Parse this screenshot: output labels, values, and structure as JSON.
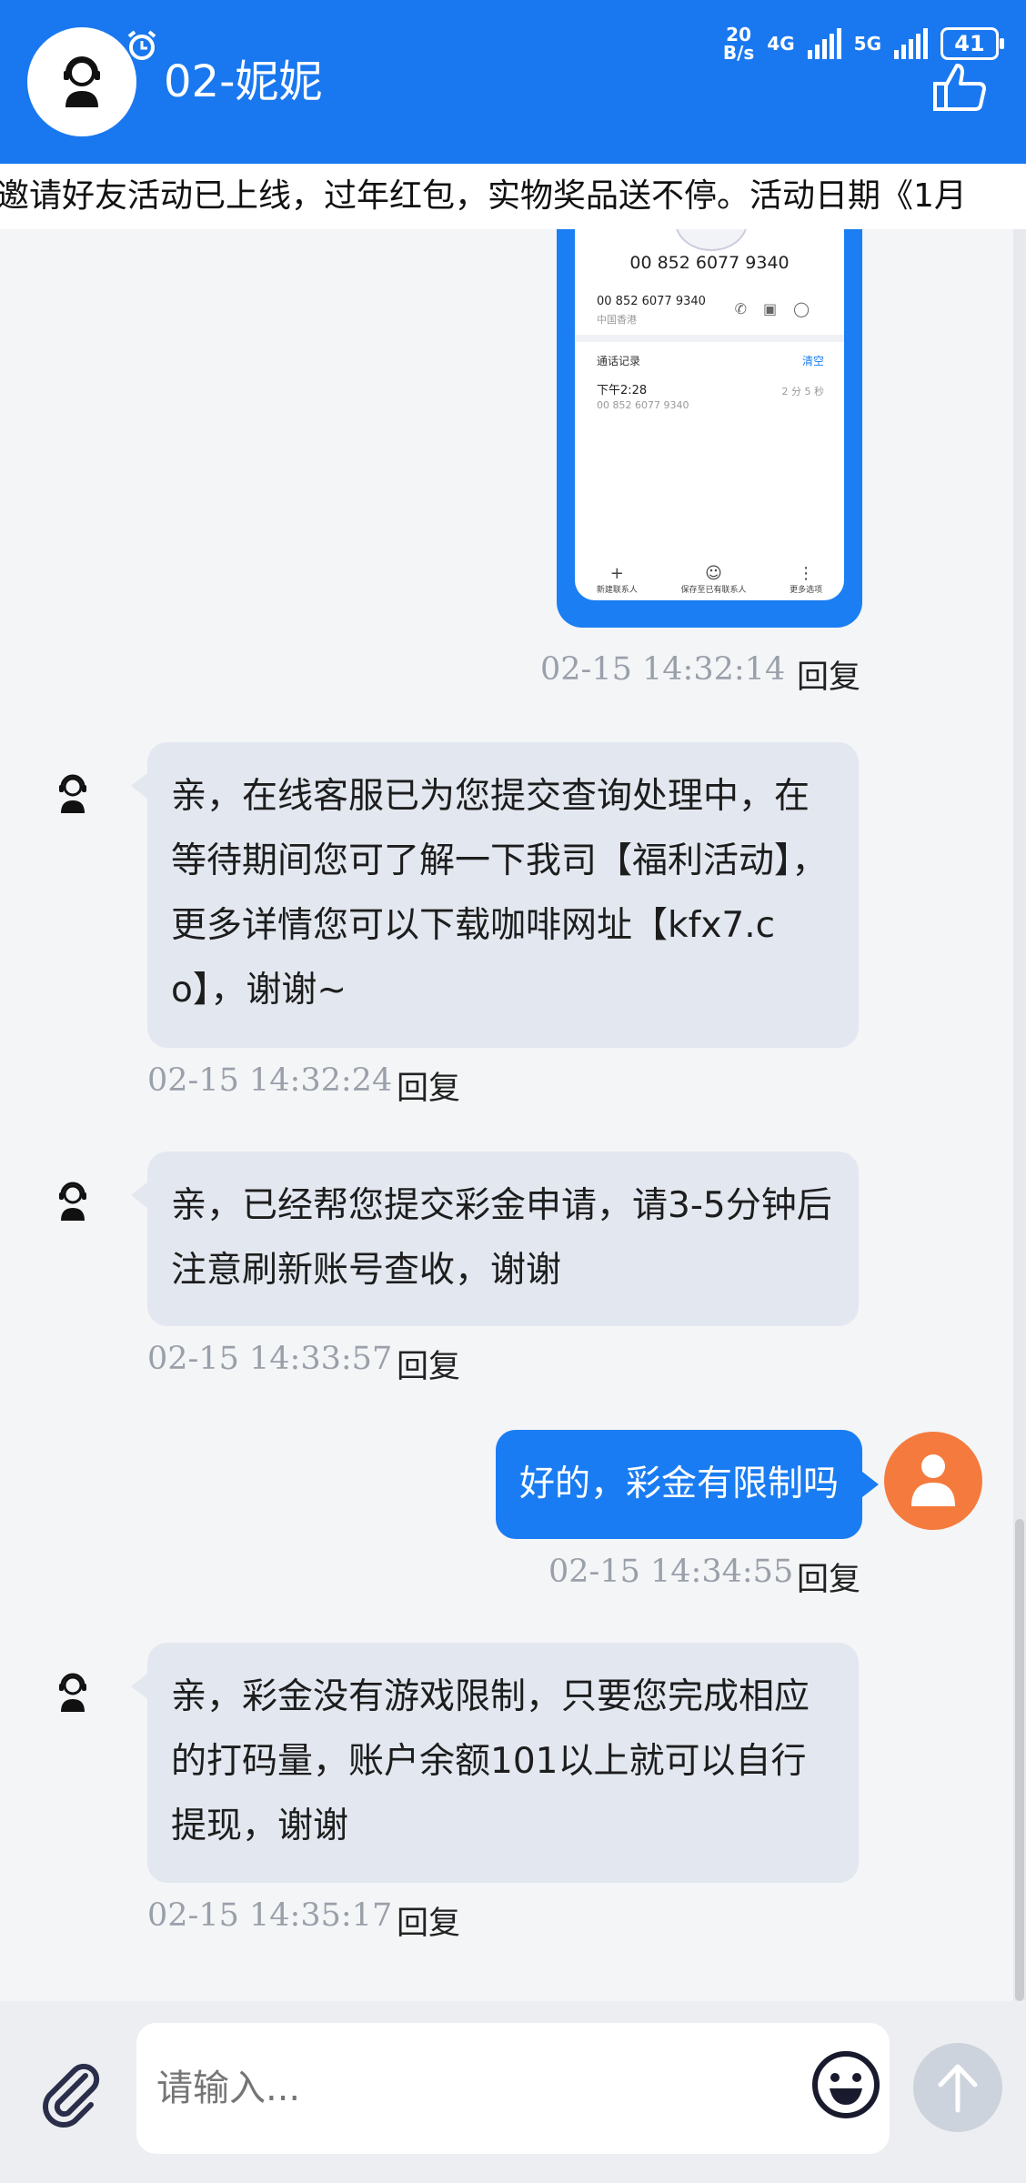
{
  "header": {
    "title": "02-妮妮",
    "status": {
      "net_speed_value": "20",
      "net_speed_unit": "B/s",
      "net1": "4G",
      "net2": "5G",
      "battery": "41"
    }
  },
  "marquee": {
    "text": "邀请好友活动已上线，过年红包，实物奖品送不停。活动日期《1月"
  },
  "screenshot": {
    "number_title": "00 852 6077 9340",
    "number_row": "00 852 6077 9340",
    "number_region": "中国香港",
    "records_label": "通话记录",
    "clear_label": "清空",
    "call_time": "下午2:28",
    "call_number": "00 852 6077 9340",
    "call_duration": "2 分 5 秒",
    "nav": [
      "新建联系人",
      "保存至已有联系人",
      "更多选项"
    ]
  },
  "messages": [
    {
      "meta_time": "02-15 14:32:14",
      "reply": "回复"
    },
    {
      "text": "亲，在线客服已为您提交查询处理中，在等待期间您可了解一下我司【福利活动】，更多详情您可以下载咖啡网址【kfx7.co】，谢谢~",
      "time": "02-15 14:32:24",
      "reply": "回复"
    },
    {
      "text": "亲，已经帮您提交彩金申请，请3-5分钟后注意刷新账号查收，谢谢",
      "time": "02-15 14:33:57",
      "reply": "回复"
    },
    {
      "text": "好的，彩金有限制吗",
      "time": "02-15 14:34:55",
      "reply": "回复"
    },
    {
      "text": "亲，彩金没有游戏限制，只要您完成相应的打码量，账户余额101以上就可以自行提现，谢谢",
      "time": "02-15 14:35:17",
      "reply": "回复"
    }
  ],
  "composer": {
    "placeholder": "请输入..."
  },
  "colors": {
    "primary": "#1978f0",
    "user_avatar": "#f47b3d",
    "agent_bubble": "#e3e8f0"
  }
}
